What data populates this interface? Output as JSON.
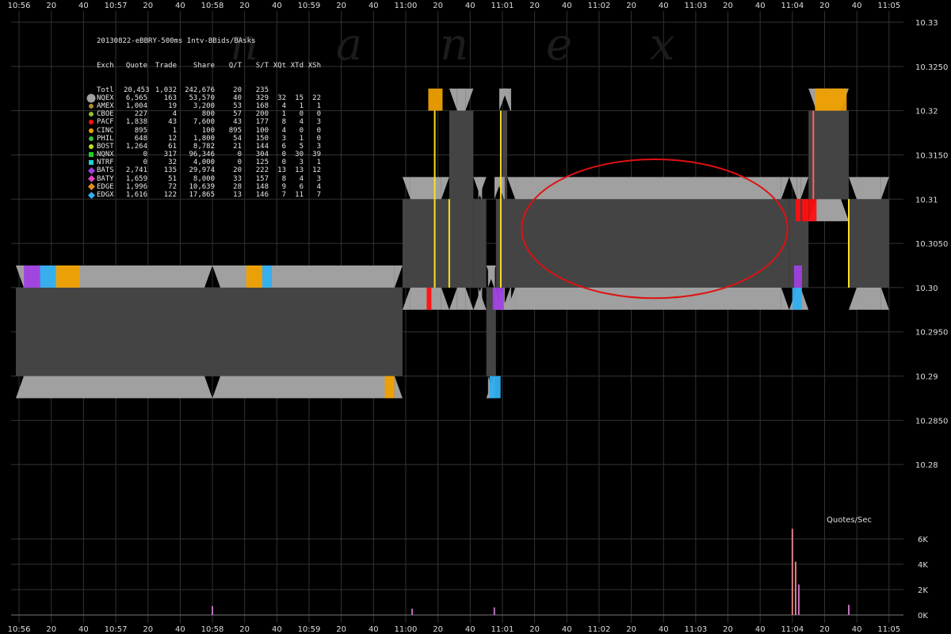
{
  "header": {
    "title": "20130822-eBBRY-500ms Intv-BBids/BAsks",
    "columns": [
      "Exch",
      "Quote",
      "Trade",
      "Share",
      "Q/T",
      "S/T",
      "XQt",
      "XTd",
      "XSh"
    ]
  },
  "legend_rows": [
    {
      "exch": "Totl",
      "quote": "20,453",
      "trade": "1,032",
      "share": "242,676",
      "qt": "20",
      "st": "235",
      "xqt": "",
      "xtd": "",
      "xsh": "",
      "color": "",
      "marker": "none"
    },
    {
      "exch": "NQEX",
      "quote": "6,565",
      "trade": "163",
      "share": "53,570",
      "qt": "40",
      "st": "329",
      "xqt": "32",
      "xtd": "15",
      "xsh": "22",
      "color": "#a0a0a0",
      "marker": "circle-large"
    },
    {
      "exch": "AMEX",
      "quote": "1,004",
      "trade": "19",
      "share": "3,200",
      "qt": "53",
      "st": "168",
      "xqt": "4",
      "xtd": "1",
      "xsh": "1",
      "color": "#b08a3a",
      "marker": "circle"
    },
    {
      "exch": "CBOE",
      "quote": "227",
      "trade": "4",
      "share": "800",
      "qt": "57",
      "st": "200",
      "xqt": "1",
      "xtd": "0",
      "xsh": "0",
      "color": "#90c030",
      "marker": "circle"
    },
    {
      "exch": "PACF",
      "quote": "1,838",
      "trade": "43",
      "share": "7,600",
      "qt": "43",
      "st": "177",
      "xqt": "8",
      "xtd": "4",
      "xsh": "3",
      "color": "#ff1010",
      "marker": "circle"
    },
    {
      "exch": "CINC",
      "quote": "895",
      "trade": "1",
      "share": "100",
      "qt": "895",
      "st": "100",
      "xqt": "4",
      "xtd": "0",
      "xsh": "0",
      "color": "#f0a000",
      "marker": "circle"
    },
    {
      "exch": "PHIL",
      "quote": "648",
      "trade": "12",
      "share": "1,800",
      "qt": "54",
      "st": "150",
      "xqt": "3",
      "xtd": "1",
      "xsh": "0",
      "color": "#40c040",
      "marker": "circle"
    },
    {
      "exch": "BOST",
      "quote": "1,264",
      "trade": "61",
      "share": "8,782",
      "qt": "21",
      "st": "144",
      "xqt": "6",
      "xtd": "5",
      "xsh": "3",
      "color": "#c0e020",
      "marker": "circle"
    },
    {
      "exch": "NQNX",
      "quote": "0",
      "trade": "317",
      "share": "96,346",
      "qt": "0",
      "st": "304",
      "xqt": "0",
      "xtd": "30",
      "xsh": "39",
      "color": "#20d020",
      "marker": "square"
    },
    {
      "exch": "NTRF",
      "quote": "0",
      "trade": "32",
      "share": "4,000",
      "qt": "0",
      "st": "125",
      "xqt": "0",
      "xtd": "3",
      "xsh": "1",
      "color": "#20d0d0",
      "marker": "square"
    },
    {
      "exch": "BATS",
      "quote": "2,741",
      "trade": "135",
      "share": "29,974",
      "qt": "20",
      "st": "222",
      "xqt": "13",
      "xtd": "13",
      "xsh": "12",
      "color": "#a040e0",
      "marker": "diamond"
    },
    {
      "exch": "BATY",
      "quote": "1,659",
      "trade": "51",
      "share": "8,000",
      "qt": "33",
      "st": "157",
      "xqt": "8",
      "xtd": "4",
      "xsh": "3",
      "color": "#e040c0",
      "marker": "diamond"
    },
    {
      "exch": "EDGE",
      "quote": "1,996",
      "trade": "72",
      "share": "10,639",
      "qt": "28",
      "st": "148",
      "xqt": "9",
      "xtd": "6",
      "xsh": "4",
      "color": "#e09020",
      "marker": "diamond"
    },
    {
      "exch": "EDGX",
      "quote": "1,616",
      "trade": "122",
      "share": "17,865",
      "qt": "13",
      "st": "146",
      "xqt": "7",
      "xtd": "11",
      "xsh": "7",
      "color": "#30b0f0",
      "marker": "diamond"
    }
  ],
  "watermark": "n a n e x",
  "quotes_label": "Quotes/Sec",
  "chart_data": {
    "type": "area",
    "x_axis": {
      "min": "10:55:58",
      "max": "11:05:05",
      "tick_labels": [
        "10:56",
        "20",
        "40",
        "10:57",
        "20",
        "40",
        "10:58",
        "20",
        "40",
        "10:59",
        "20",
        "40",
        "11:00",
        "20",
        "40",
        "11:01",
        "20",
        "40",
        "11:02",
        "20",
        "40",
        "11:03",
        "20",
        "40",
        "11:04",
        "20",
        "40",
        "11:05"
      ]
    },
    "y_axis": {
      "min": 10.275,
      "max": 10.33,
      "tick_labels": [
        "10.33",
        "10.3250",
        "10.32",
        "10.3150",
        "10.31",
        "10.3050",
        "10.30",
        "10.2950",
        "10.29",
        "10.2850",
        "10.28"
      ]
    },
    "volume_axis": {
      "min": 0,
      "max": 6000,
      "unit": "Quotes/Sec",
      "tick_labels": [
        "6K",
        "4K",
        "2K",
        "0K"
      ]
    },
    "nbbo_spans": [
      {
        "start": "10:55:58",
        "end": "10:58:00",
        "bid": 10.29,
        "ask": 10.3
      },
      {
        "start": "10:58:00",
        "end": "10:59:58",
        "bid": 10.29,
        "ask": 10.3
      },
      {
        "start": "10:59:58",
        "end": "11:00:27",
        "bid": 10.3,
        "ask": 10.31
      },
      {
        "start": "11:00:27",
        "end": "11:00:42",
        "bid": 10.3,
        "ask": 10.32
      },
      {
        "start": "11:00:42",
        "end": "11:00:50",
        "bid": 10.3,
        "ask": 10.31
      },
      {
        "start": "11:00:50",
        "end": "11:00:56",
        "bid": 10.29,
        "ask": 10.3
      },
      {
        "start": "11:00:56",
        "end": "11:01:00",
        "bid": 10.3,
        "ask": 10.31
      },
      {
        "start": "11:01:00",
        "end": "11:01:03",
        "bid": 10.3,
        "ask": 10.32
      },
      {
        "start": "11:01:03",
        "end": "11:03:58",
        "bid": 10.3,
        "ask": 10.31
      },
      {
        "start": "11:03:58",
        "end": "11:04:10",
        "bid": 10.3,
        "ask": 10.31
      },
      {
        "start": "11:04:10",
        "end": "11:04:35",
        "bid": 10.31,
        "ask": 10.32
      },
      {
        "start": "11:04:35",
        "end": "11:05:00",
        "bid": 10.3,
        "ask": 10.31
      }
    ],
    "quote_rate_spikes": [
      {
        "t": "11:04:00",
        "value": 6800
      },
      {
        "t": "11:04:02",
        "value": 4200
      },
      {
        "t": "11:04:04",
        "value": 2400
      },
      {
        "t": "10:58:00",
        "value": 700
      },
      {
        "t": "11:00:55",
        "value": 600
      },
      {
        "t": "11:00:04",
        "value": 500
      },
      {
        "t": "11:04:35",
        "value": 800
      }
    ],
    "annotation": {
      "shape": "ellipse",
      "color": "#e01010",
      "t_start": "11:01:12",
      "t_end": "11:03:57",
      "price_low": 10.2988,
      "price_high": 10.3145
    },
    "grid": true,
    "legend_position": "top-left"
  }
}
